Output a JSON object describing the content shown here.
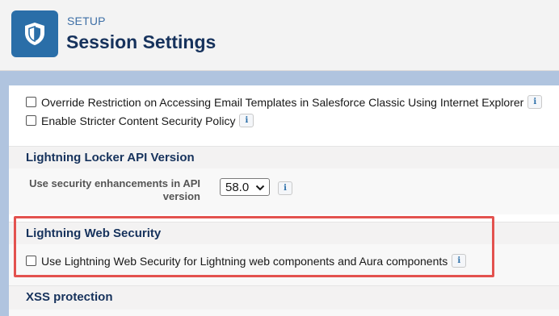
{
  "header": {
    "kicker": "SETUP",
    "title": "Session Settings",
    "icon": "shield-icon",
    "icon_bg": "#2a6ea8"
  },
  "options": {
    "override_restriction": "Override Restriction on Accessing Email Templates in Salesforce Classic Using Internet Explorer",
    "stricter_csp": "Enable Stricter Content Security Policy"
  },
  "locker": {
    "section_title": "Lightning Locker API Version",
    "field_label": "Use security enhancements in API version",
    "selected_version": "58.0"
  },
  "lws": {
    "section_title": "Lightning Web Security",
    "checkbox_label": "Use Lightning Web Security for Lightning web components and Aura components",
    "highlight_color": "#e3524f"
  },
  "xss": {
    "section_title": "XSS protection"
  },
  "info_icon_glyph": "i"
}
